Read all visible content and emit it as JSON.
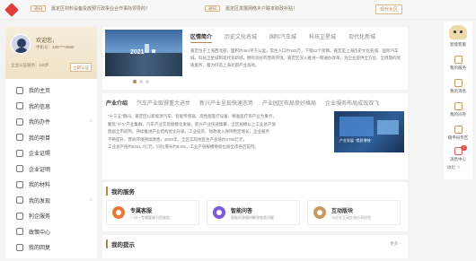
{
  "topbar": {
    "notice1_tag": "通知",
    "notice1_text": "嘉定区材料设备投放预行政事业合作事际领导的！",
    "notice2_tag": "通知",
    "notice2_text": "嘉定区发展网络乡户联本财政补贴！",
    "action_label": "现代化区"
  },
  "profile": {
    "greeting": "欢迎您，",
    "mobile": "手机号：188****8888",
    "cert_text": "企业认证服务：1/6步",
    "cert_button": "立即认证"
  },
  "sidebar": {
    "items": [
      {
        "label": "我的主页",
        "arrow": ""
      },
      {
        "label": "我的信息",
        "arrow": ""
      },
      {
        "label": "我的办件",
        "arrow": "›"
      },
      {
        "label": "我的项目",
        "arrow": ""
      },
      {
        "label": "企业证照",
        "arrow": ""
      },
      {
        "label": "企业证明",
        "arrow": ""
      },
      {
        "label": "我的材料",
        "arrow": ""
      },
      {
        "label": "我的发现",
        "arrow": "›"
      },
      {
        "label": "利企服务",
        "arrow": ""
      },
      {
        "label": "政策中心",
        "arrow": ""
      },
      {
        "label": "我的回复",
        "arrow": ""
      }
    ]
  },
  "banner": {
    "year": "2021",
    "tabs": [
      "区情简介",
      "历史文化名城",
      "国际汽车城",
      "科技卫星城",
      "现代化新城"
    ],
    "description": "嘉定位于上海西北部，面积约464平方公里，常住人口约183万，下辖12个街镇。嘉定是上海历史文化名城、国际汽车城、科技卫星城和现代化新城，拥有良好的营商环境。嘉定区深入推进一网通办改革，为企业提供全方位、全周期的优质服务，着力打造上海北部产业高地。"
  },
  "industry": {
    "tabs": [
      "产业介绍",
      "汽车产业取得重大进步",
      "新兴产业呈现快速态势",
      "产业园区布局良好格局",
      "企业服务布局成效双飞"
    ],
    "lines": [
      "\"十三五\"期间，嘉定区以新能源汽车、智能传感器、高性能医疗设备、精准医疗等产业为重点，",
      "聚焦\"4+X\"产业集群，汽车产业实现规模化发展，新兴产业快速集聚，全区规模以上工业总产值",
      "稳居全市前列。持续推进产业结构优化升级，工业投资、财政收入保持稳定增长，企业服务",
      "不断提升，营商环境持续改善。2020年，全区实现地区生产总值约2700亿元，",
      "工业总产值约5341.7亿元，同比增长约6.0%，工业产值规模继续位居全市各区前列。"
    ],
    "image_caption": "产业发展 \"提质增效\""
  },
  "services": {
    "title": "我的服务",
    "items": [
      {
        "title": "专属客服",
        "sub": "一对一专属客服为您服务"
      },
      {
        "title": "智能问答",
        "sub": "智能问答随时解答各类问题"
      },
      {
        "title": "互动版块",
        "sub": "与企业互动交流分享经验"
      }
    ],
    "colors": [
      "#e8783a",
      "#7b5bd6",
      "#c49a5e"
    ]
  },
  "tips": {
    "title": "我的提示",
    "more": "更多 ›"
  },
  "rail": {
    "bot_label": "智能客服",
    "items": [
      "我的服务",
      "我的消息",
      "我的问卷",
      "随申码专区",
      "消息中心"
    ],
    "badge": "1",
    "collapse": "收起 ∧"
  }
}
